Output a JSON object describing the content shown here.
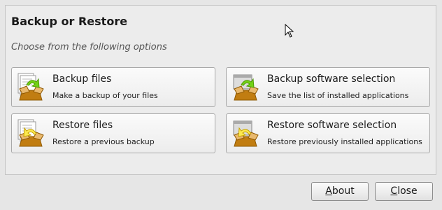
{
  "dialog": {
    "title": "Backup or Restore",
    "subtitle": "Choose from the following options"
  },
  "options": [
    {
      "label": "Backup files",
      "description": "Make a backup of your files",
      "icon": "backup-files-icon"
    },
    {
      "label": "Backup software selection",
      "description": "Save the list of installed applications",
      "icon": "backup-software-icon"
    },
    {
      "label": "Restore files",
      "description": "Restore a previous backup",
      "icon": "restore-files-icon"
    },
    {
      "label": "Restore software selection",
      "description": "Restore previously installed applications",
      "icon": "restore-software-icon"
    }
  ],
  "buttons": {
    "about": {
      "mnemonic": "A",
      "rest": "bout"
    },
    "close": {
      "mnemonic": "C",
      "rest": "lose"
    }
  },
  "colors": {
    "arrow_backup": "#4e9a06",
    "arrow_restore": "#edd400",
    "box": "#c17d11"
  }
}
